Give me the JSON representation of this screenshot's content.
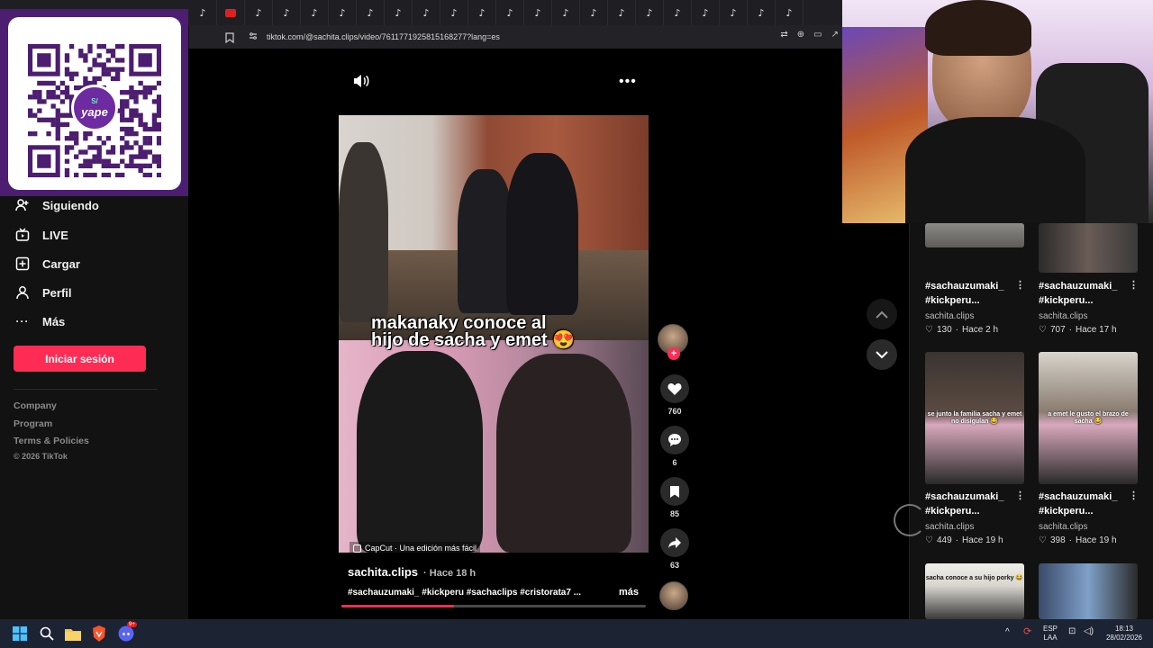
{
  "browser": {
    "url": "tiktok.com/@sachita.clips/video/7611771925815168277?lang=es",
    "tab_glyph": "♪",
    "tab_count": 22
  },
  "qr": {
    "currency_symbol": "S/",
    "brand": "yape",
    "brand_color": "#6d2aa1",
    "panel_color": "#4c1d70"
  },
  "sidebar": {
    "items": [
      {
        "label": "Siguiendo",
        "icon": "following-icon"
      },
      {
        "label": "LIVE",
        "icon": "live-icon"
      },
      {
        "label": "Cargar",
        "icon": "upload-icon"
      },
      {
        "label": "Perfil",
        "icon": "profile-icon"
      },
      {
        "label": "Más",
        "icon": "more-icon"
      }
    ],
    "login_label": "Iniciar sesión",
    "footer_links": [
      "Company",
      "Program",
      "Terms & Policies"
    ],
    "copyright": "© 2026 TikTok"
  },
  "video": {
    "caption_line1": "makanaky conoce al",
    "caption_line2": "hijo de sacha y emet 😍",
    "capcut_tag": "CapCut · Una edición más fácil",
    "author": "sachita.clips",
    "time_ago": "Hace 18 h",
    "description": "#sachauzumaki_ #kickperu #sachaclips #cristorata7 ...",
    "more_label": "más",
    "progress": 0.37,
    "accent_color": "#fe2c55"
  },
  "actions": {
    "likes": "760",
    "comments": "6",
    "saves": "85",
    "shares": "63"
  },
  "grid": {
    "cards": [
      {
        "title_line1": "#sachauzumaki_",
        "title_line2": "#kickperu...",
        "author": "sachita.clips",
        "likes": "130",
        "time": "Hace 2 h",
        "overlay": ""
      },
      {
        "title_line1": "#sachauzumaki_",
        "title_line2": "#kickperu...",
        "author": "sachita.clips",
        "likes": "707",
        "time": "Hace 17 h",
        "overlay": ""
      },
      {
        "title_line1": "#sachauzumaki_",
        "title_line2": "#kickperu...",
        "author": "sachita.clips",
        "likes": "449",
        "time": "Hace 19 h",
        "overlay": "se junto la familia sacha y emet no disigulan 😂"
      },
      {
        "title_line1": "#sachauzumaki_",
        "title_line2": "#kickperu...",
        "author": "sachita.clips",
        "likes": "398",
        "time": "Hace 19 h",
        "overlay": "a emet le gusto el brazo de sacha 😂"
      },
      {
        "title_line1": "",
        "title_line2": "",
        "author": "",
        "likes": "",
        "time": "",
        "overlay": "sacha conoce a su hijo porky 😂"
      },
      {
        "title_line1": "",
        "title_line2": "",
        "author": "",
        "likes": "",
        "time": "",
        "overlay": ""
      }
    ]
  },
  "taskbar": {
    "lang_line1": "ESP",
    "lang_line2": "LAA",
    "time": "18:13",
    "date": "28/02/2026",
    "discord_badge": "9+"
  }
}
